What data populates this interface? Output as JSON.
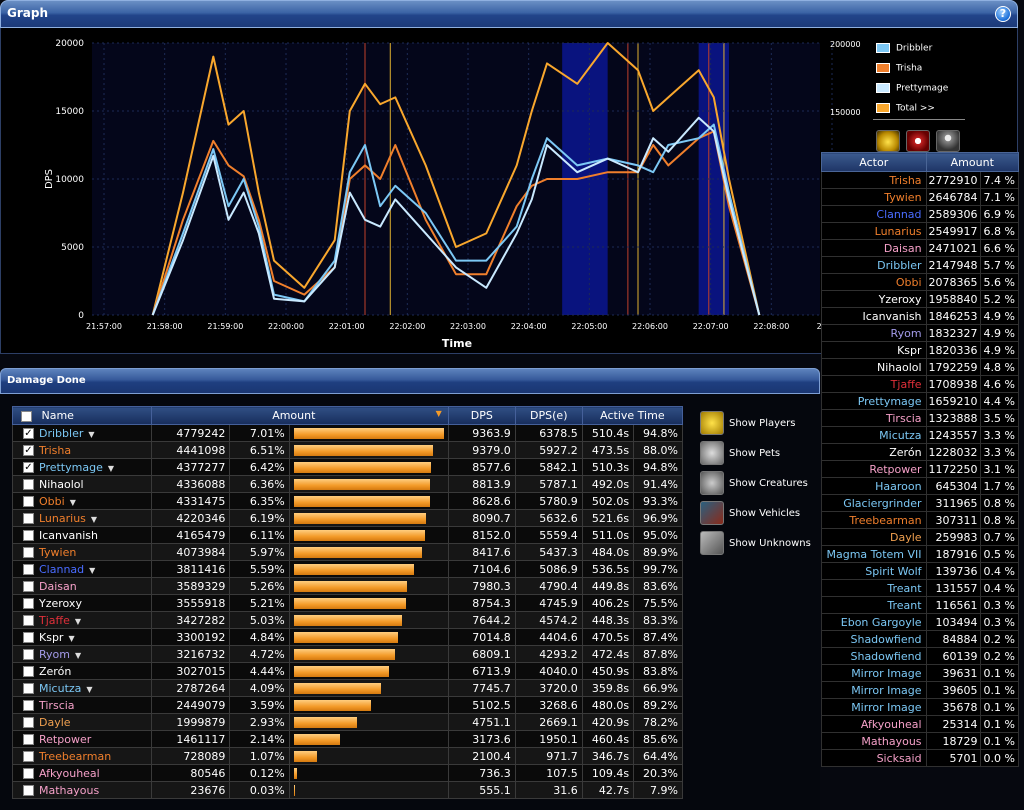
{
  "graph": {
    "title": "Graph",
    "help_icon": "?",
    "y_axis_label": "DPS",
    "x_axis_label": "Time",
    "y_ticks": [
      "0",
      "5000",
      "10000",
      "15000",
      "20000"
    ],
    "y2_ticks": [
      "150000",
      "200000"
    ],
    "x_ticks": [
      "21:57:00",
      "21:58:00",
      "21:59:00",
      "22:00:00",
      "22:01:00",
      "22:02:00",
      "22:03:00",
      "22:04:00",
      "22:05:00",
      "22:06:00",
      "22:07:00",
      "22:08:00",
      "22:09:0"
    ],
    "legend": [
      {
        "label": "Dribbler",
        "color": "#7cc8f5"
      },
      {
        "label": "Trisha",
        "color": "#f07f2c"
      },
      {
        "label": "Prettymage",
        "color": "#c9e9ff"
      },
      {
        "label": "Total >>",
        "color": "#f9a72d"
      }
    ]
  },
  "chart_data": {
    "type": "line",
    "ylabel": "DPS",
    "xlabel": "Time",
    "ylim": [
      0,
      20000
    ],
    "x": [
      "21:58:00",
      "21:58:30",
      "21:59:00",
      "21:59:15",
      "21:59:30",
      "21:59:45",
      "22:00:00",
      "22:00:30",
      "22:01:00",
      "22:01:15",
      "22:01:30",
      "22:01:45",
      "22:02:00",
      "22:02:30",
      "22:03:00",
      "22:03:30",
      "22:04:00",
      "22:04:15",
      "22:04:30",
      "22:05:00",
      "22:05:30",
      "22:06:00",
      "22:06:15",
      "22:06:30",
      "22:07:00",
      "22:07:15",
      "22:07:30",
      "22:08:00"
    ],
    "series": [
      {
        "name": "Total >>",
        "color": "#f9a72d",
        "values": [
          0,
          9000,
          19000,
          14000,
          15000,
          9000,
          4000,
          2000,
          5500,
          15000,
          17000,
          15500,
          16000,
          11000,
          5000,
          6000,
          11000,
          15000,
          18500,
          17000,
          20000,
          18000,
          15000,
          16000,
          18000,
          16000,
          10000,
          0
        ]
      },
      {
        "name": "Trisha",
        "color": "#f07f2c",
        "values": [
          0,
          7000,
          12800,
          11000,
          10200,
          7000,
          2500,
          1500,
          3500,
          10000,
          11000,
          10000,
          12500,
          7000,
          3000,
          3000,
          8000,
          9500,
          10000,
          10000,
          10500,
          10500,
          12500,
          11000,
          13000,
          13500,
          8000,
          0
        ]
      },
      {
        "name": "Dribbler",
        "color": "#7cc8f5",
        "values": [
          0,
          6000,
          12200,
          8000,
          10000,
          6500,
          1500,
          1000,
          4000,
          10500,
          12500,
          8000,
          9500,
          7500,
          4000,
          4000,
          6500,
          10000,
          13000,
          11000,
          11500,
          11000,
          10500,
          12500,
          13000,
          14000,
          9000,
          0
        ]
      },
      {
        "name": "Prettymage",
        "color": "#c9e9ff",
        "values": [
          0,
          5500,
          11700,
          7000,
          9000,
          6000,
          1200,
          1000,
          3500,
          9000,
          7000,
          6500,
          8500,
          6000,
          3500,
          2000,
          6000,
          8500,
          12500,
          10500,
          11500,
          10500,
          13000,
          12000,
          14500,
          13500,
          8500,
          0
        ]
      }
    ]
  },
  "filter_icons": [
    "paw-icon",
    "skull-crossed-icon",
    "person-icon"
  ],
  "actor_table": {
    "headers": [
      "Actor",
      "Amount"
    ],
    "rows": [
      {
        "name": "Trisha",
        "amount": "2772910",
        "pct": "7.4 %",
        "color": "#f07f2c"
      },
      {
        "name": "Tywien",
        "amount": "2646784",
        "pct": "7.1 %",
        "color": "#f07f2c"
      },
      {
        "name": "Clannad",
        "amount": "2589306",
        "pct": "6.9 %",
        "color": "#4a6cff"
      },
      {
        "name": "Lunarius",
        "amount": "2549917",
        "pct": "6.8 %",
        "color": "#f07f2c"
      },
      {
        "name": "Daisan",
        "amount": "2471021",
        "pct": "6.6 %",
        "color": "#f5a0c8"
      },
      {
        "name": "Dribbler",
        "amount": "2147948",
        "pct": "5.7 %",
        "color": "#7cc8f5"
      },
      {
        "name": "Obbi",
        "amount": "2078365",
        "pct": "5.6 %",
        "color": "#f07f2c"
      },
      {
        "name": "Yzeroxy",
        "amount": "1958840",
        "pct": "5.2 %",
        "color": "#ffffff"
      },
      {
        "name": "Icanvanish",
        "amount": "1846253",
        "pct": "4.9 %",
        "color": "#ffffff"
      },
      {
        "name": "Ryom",
        "amount": "1832327",
        "pct": "4.9 %",
        "color": "#a29ae8"
      },
      {
        "name": "Kspr",
        "amount": "1820336",
        "pct": "4.9 %",
        "color": "#ffffff"
      },
      {
        "name": "Nihaolol",
        "amount": "1792259",
        "pct": "4.8 %",
        "color": "#ffffff"
      },
      {
        "name": "Tjaffe",
        "amount": "1708938",
        "pct": "4.6 %",
        "color": "#e0303a"
      },
      {
        "name": "Prettymage",
        "amount": "1659210",
        "pct": "4.4 %",
        "color": "#7cc8f5"
      },
      {
        "name": "Tirscia",
        "amount": "1323888",
        "pct": "3.5 %",
        "color": "#f5a0c8"
      },
      {
        "name": "Micutza",
        "amount": "1243557",
        "pct": "3.3 %",
        "color": "#7cc8f5"
      },
      {
        "name": "Zerón",
        "amount": "1228032",
        "pct": "3.3 %",
        "color": "#ffffff"
      },
      {
        "name": "Retpower",
        "amount": "1172250",
        "pct": "3.1 %",
        "color": "#f5a0c8"
      },
      {
        "name": "Haaroon",
        "amount": "645304",
        "pct": "1.7 %",
        "color": "#7cc8f5"
      },
      {
        "name": "Glaciergrinder",
        "amount": "311965",
        "pct": "0.8 %",
        "color": "#7cc8f5"
      },
      {
        "name": "Treebearman",
        "amount": "307311",
        "pct": "0.8 %",
        "color": "#f07f2c"
      },
      {
        "name": "Dayle",
        "amount": "259983",
        "pct": "0.7 %",
        "color": "#f0a050"
      },
      {
        "name": "Magma Totem VII",
        "amount": "187916",
        "pct": "0.5 %",
        "color": "#7cc8f5"
      },
      {
        "name": "Spirit Wolf",
        "amount": "139736",
        "pct": "0.4 %",
        "color": "#7cc8f5"
      },
      {
        "name": "Treant",
        "amount": "131557",
        "pct": "0.4 %",
        "color": "#7cc8f5"
      },
      {
        "name": "Treant",
        "amount": "116561",
        "pct": "0.3 %",
        "color": "#7cc8f5"
      },
      {
        "name": "Ebon Gargoyle",
        "amount": "103494",
        "pct": "0.3 %",
        "color": "#7cc8f5"
      },
      {
        "name": "Shadowfiend",
        "amount": "84884",
        "pct": "0.2 %",
        "color": "#7cc8f5"
      },
      {
        "name": "Shadowfiend",
        "amount": "60139",
        "pct": "0.2 %",
        "color": "#7cc8f5"
      },
      {
        "name": "Mirror Image",
        "amount": "39631",
        "pct": "0.1 %",
        "color": "#7cc8f5"
      },
      {
        "name": "Mirror Image",
        "amount": "39605",
        "pct": "0.1 %",
        "color": "#7cc8f5"
      },
      {
        "name": "Mirror Image",
        "amount": "35678",
        "pct": "0.1 %",
        "color": "#7cc8f5"
      },
      {
        "name": "Afkyouheal",
        "amount": "25314",
        "pct": "0.1 %",
        "color": "#f5a0c8"
      },
      {
        "name": "Mathayous",
        "amount": "18729",
        "pct": "0.1 %",
        "color": "#f5a0c8"
      },
      {
        "name": "Sicksaid",
        "amount": "5701",
        "pct": "0.0 %",
        "color": "#f5a0c8"
      }
    ]
  },
  "damage_done": {
    "title": "Damage Done",
    "headers": {
      "name": "Name",
      "amount": "Amount",
      "dps": "DPS",
      "dpse": "DPS(e)",
      "active": "Active Time"
    },
    "rows": [
      {
        "name": "Dribbler",
        "color": "#7cc8f5",
        "checked": true,
        "caret": true,
        "amount": "4779242",
        "pct": "7.01%",
        "fill": 1.0,
        "dps": "9363.9",
        "dpse": "6378.5",
        "time": "510.4s",
        "tpct": "94.8%"
      },
      {
        "name": "Trisha",
        "color": "#f07f2c",
        "checked": true,
        "caret": false,
        "amount": "4441098",
        "pct": "6.51%",
        "fill": 0.929,
        "dps": "9379.0",
        "dpse": "5927.2",
        "time": "473.5s",
        "tpct": "88.0%"
      },
      {
        "name": "Prettymage",
        "color": "#7cc8f5",
        "checked": true,
        "caret": true,
        "amount": "4377277",
        "pct": "6.42%",
        "fill": 0.916,
        "dps": "8577.6",
        "dpse": "5842.1",
        "time": "510.3s",
        "tpct": "94.8%"
      },
      {
        "name": "Nihaolol",
        "color": "#ffffff",
        "checked": false,
        "caret": false,
        "amount": "4336088",
        "pct": "6.36%",
        "fill": 0.907,
        "dps": "8813.9",
        "dpse": "5787.1",
        "time": "492.0s",
        "tpct": "91.4%"
      },
      {
        "name": "Obbi",
        "color": "#f07f2c",
        "checked": false,
        "caret": true,
        "amount": "4331475",
        "pct": "6.35%",
        "fill": 0.906,
        "dps": "8628.6",
        "dpse": "5780.9",
        "time": "502.0s",
        "tpct": "93.3%"
      },
      {
        "name": "Lunarius",
        "color": "#f07f2c",
        "checked": false,
        "caret": true,
        "amount": "4220346",
        "pct": "6.19%",
        "fill": 0.883,
        "dps": "8090.7",
        "dpse": "5632.6",
        "time": "521.6s",
        "tpct": "96.9%"
      },
      {
        "name": "Icanvanish",
        "color": "#ffffff",
        "checked": false,
        "caret": false,
        "amount": "4165479",
        "pct": "6.11%",
        "fill": 0.872,
        "dps": "8152.0",
        "dpse": "5559.4",
        "time": "511.0s",
        "tpct": "95.0%"
      },
      {
        "name": "Tywien",
        "color": "#f07f2c",
        "checked": false,
        "caret": false,
        "amount": "4073984",
        "pct": "5.97%",
        "fill": 0.852,
        "dps": "8417.6",
        "dpse": "5437.3",
        "time": "484.0s",
        "tpct": "89.9%"
      },
      {
        "name": "Clannad",
        "color": "#4a6cff",
        "checked": false,
        "caret": true,
        "amount": "3811416",
        "pct": "5.59%",
        "fill": 0.797,
        "dps": "7104.6",
        "dpse": "5086.9",
        "time": "536.5s",
        "tpct": "99.7%"
      },
      {
        "name": "Daisan",
        "color": "#f5a0c8",
        "checked": false,
        "caret": false,
        "amount": "3589329",
        "pct": "5.26%",
        "fill": 0.751,
        "dps": "7980.3",
        "dpse": "4790.4",
        "time": "449.8s",
        "tpct": "83.6%"
      },
      {
        "name": "Yzeroxy",
        "color": "#ffffff",
        "checked": false,
        "caret": false,
        "amount": "3555918",
        "pct": "5.21%",
        "fill": 0.744,
        "dps": "8754.3",
        "dpse": "4745.9",
        "time": "406.2s",
        "tpct": "75.5%"
      },
      {
        "name": "Tjaffe",
        "color": "#e0303a",
        "checked": false,
        "caret": true,
        "amount": "3427282",
        "pct": "5.03%",
        "fill": 0.717,
        "dps": "7644.2",
        "dpse": "4574.2",
        "time": "448.3s",
        "tpct": "83.3%"
      },
      {
        "name": "Kspr",
        "color": "#ffffff",
        "checked": false,
        "caret": true,
        "amount": "3300192",
        "pct": "4.84%",
        "fill": 0.691,
        "dps": "7014.8",
        "dpse": "4404.6",
        "time": "470.5s",
        "tpct": "87.4%"
      },
      {
        "name": "Ryom",
        "color": "#a29ae8",
        "checked": false,
        "caret": true,
        "amount": "3216732",
        "pct": "4.72%",
        "fill": 0.673,
        "dps": "6809.1",
        "dpse": "4293.2",
        "time": "472.4s",
        "tpct": "87.8%"
      },
      {
        "name": "Zerón",
        "color": "#ffffff",
        "checked": false,
        "caret": false,
        "amount": "3027015",
        "pct": "4.44%",
        "fill": 0.633,
        "dps": "6713.9",
        "dpse": "4040.0",
        "time": "450.9s",
        "tpct": "83.8%"
      },
      {
        "name": "Micutza",
        "color": "#7cc8f5",
        "checked": false,
        "caret": true,
        "amount": "2787264",
        "pct": "4.09%",
        "fill": 0.583,
        "dps": "7745.7",
        "dpse": "3720.0",
        "time": "359.8s",
        "tpct": "66.9%"
      },
      {
        "name": "Tirscia",
        "color": "#f5a0c8",
        "checked": false,
        "caret": false,
        "amount": "2449079",
        "pct": "3.59%",
        "fill": 0.512,
        "dps": "5102.5",
        "dpse": "3268.6",
        "time": "480.0s",
        "tpct": "89.2%"
      },
      {
        "name": "Dayle",
        "color": "#f0a050",
        "checked": false,
        "caret": false,
        "amount": "1999879",
        "pct": "2.93%",
        "fill": 0.418,
        "dps": "4751.1",
        "dpse": "2669.1",
        "time": "420.9s",
        "tpct": "78.2%"
      },
      {
        "name": "Retpower",
        "color": "#f5a0c8",
        "checked": false,
        "caret": false,
        "amount": "1461117",
        "pct": "2.14%",
        "fill": 0.306,
        "dps": "3173.6",
        "dpse": "1950.1",
        "time": "460.4s",
        "tpct": "85.6%"
      },
      {
        "name": "Treebearman",
        "color": "#f07f2c",
        "checked": false,
        "caret": false,
        "amount": "728089",
        "pct": "1.07%",
        "fill": 0.152,
        "dps": "2100.4",
        "dpse": "971.7",
        "time": "346.7s",
        "tpct": "64.4%"
      },
      {
        "name": "Afkyouheal",
        "color": "#f5a0c8",
        "checked": false,
        "caret": false,
        "amount": "80546",
        "pct": "0.12%",
        "fill": 0.017,
        "dps": "736.3",
        "dpse": "107.5",
        "time": "109.4s",
        "tpct": "20.3%"
      },
      {
        "name": "Mathayous",
        "color": "#f5a0c8",
        "checked": false,
        "caret": false,
        "amount": "23676",
        "pct": "0.03%",
        "fill": 0.005,
        "dps": "555.1",
        "dpse": "31.6",
        "time": "42.7s",
        "tpct": "7.9%"
      }
    ]
  },
  "side_buttons": [
    {
      "label": "Show Players",
      "icon": "players-icon"
    },
    {
      "label": "Show Pets",
      "icon": "pets-icon"
    },
    {
      "label": "Show Creatures",
      "icon": "creatures-icon"
    },
    {
      "label": "Show Vehicles",
      "icon": "vehicles-icon"
    },
    {
      "label": "Show Unknowns",
      "icon": "unknowns-icon"
    }
  ]
}
